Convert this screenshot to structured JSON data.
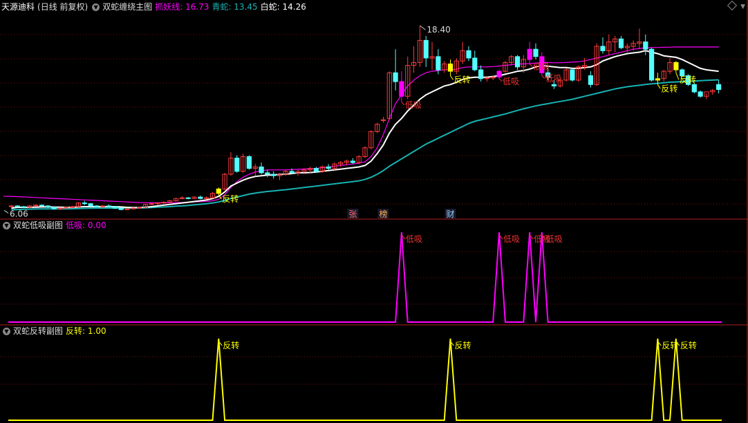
{
  "header": {
    "stock": "天源迪科",
    "period": "(日线 前复权)",
    "main_name": "双蛇缠绕主图",
    "ind1_label": "抓妖线: 16.73",
    "ind2_label": "青蛇: 13.45",
    "ind3_label": "白蛇: 14.26",
    "sub1_name": "双蛇低吸副图",
    "sub1_label": "低吸: 0.00",
    "sub2_name": "双蛇反转副图",
    "sub2_label": "反转: 1.00"
  },
  "colors": {
    "up": "#ff3b3b",
    "down": "#54ffff",
    "magenta": "#ff00ff",
    "white": "#ffffff",
    "teal": "#17b3b3",
    "yellow": "#ffff00",
    "panel_border": "#b41e1e",
    "grid": "#7a1010"
  },
  "chart_data": {
    "type": "candlestick",
    "main": {
      "ylim": [
        5.5,
        19.5
      ],
      "high_marker": "18.40",
      "low_marker": "6.06",
      "markers": [
        "张",
        "榜",
        "财"
      ],
      "signal_low": "低吸",
      "signal_rev": "反转",
      "candles": [
        [
          6.3,
          6.4,
          6.2,
          6.35
        ],
        [
          6.35,
          6.4,
          6.25,
          6.3
        ],
        [
          6.3,
          6.35,
          6.2,
          6.25
        ],
        [
          6.25,
          6.4,
          6.2,
          6.35
        ],
        [
          6.35,
          6.45,
          6.3,
          6.4
        ],
        [
          6.4,
          6.45,
          6.3,
          6.35
        ],
        [
          6.35,
          6.4,
          6.2,
          6.25
        ],
        [
          6.25,
          6.3,
          6.1,
          6.15
        ],
        [
          6.15,
          6.25,
          6.06,
          6.2
        ],
        [
          6.2,
          6.3,
          6.15,
          6.25
        ],
        [
          6.25,
          6.35,
          6.2,
          6.3
        ],
        [
          6.3,
          6.6,
          6.25,
          6.55
        ],
        [
          6.55,
          6.7,
          6.4,
          6.5
        ],
        [
          6.5,
          6.55,
          6.3,
          6.35
        ],
        [
          6.35,
          6.4,
          6.25,
          6.3
        ],
        [
          6.3,
          6.4,
          6.2,
          6.35
        ],
        [
          6.35,
          6.45,
          6.25,
          6.3
        ],
        [
          6.3,
          6.35,
          6.15,
          6.2
        ],
        [
          6.2,
          6.25,
          6.05,
          6.1
        ],
        [
          6.1,
          6.2,
          6.05,
          6.15
        ],
        [
          6.15,
          6.25,
          6.1,
          6.2
        ],
        [
          6.2,
          6.3,
          6.15,
          6.25
        ],
        [
          6.25,
          6.5,
          6.2,
          6.45
        ],
        [
          6.45,
          6.55,
          6.4,
          6.5
        ],
        [
          6.5,
          6.6,
          6.4,
          6.55
        ],
        [
          6.55,
          6.65,
          6.5,
          6.6
        ],
        [
          6.6,
          6.75,
          6.55,
          6.7
        ],
        [
          6.7,
          6.9,
          6.65,
          6.85
        ],
        [
          6.85,
          7.0,
          6.8,
          6.9
        ],
        [
          6.9,
          6.95,
          6.8,
          6.85
        ],
        [
          6.85,
          7.0,
          6.8,
          6.95
        ],
        [
          6.95,
          7.05,
          6.8,
          6.85
        ],
        [
          6.85,
          7.0,
          6.8,
          6.9
        ],
        [
          6.9,
          7.3,
          6.85,
          7.2
        ],
        [
          7.2,
          7.6,
          7.1,
          7.5
        ],
        [
          7.5,
          8.6,
          7.4,
          8.5
        ],
        [
          8.5,
          10.0,
          8.4,
          9.6
        ],
        [
          9.6,
          9.8,
          8.6,
          8.7
        ],
        [
          8.7,
          9.9,
          8.6,
          9.7
        ],
        [
          9.7,
          9.8,
          8.8,
          8.9
        ],
        [
          8.9,
          9.2,
          8.4,
          9.0
        ],
        [
          9.0,
          9.3,
          8.5,
          8.6
        ],
        [
          8.6,
          8.8,
          8.3,
          8.5
        ],
        [
          8.5,
          8.7,
          8.2,
          8.4
        ],
        [
          8.4,
          8.6,
          8.1,
          8.5
        ],
        [
          8.5,
          8.8,
          8.4,
          8.7
        ],
        [
          8.7,
          8.9,
          8.5,
          8.6
        ],
        [
          8.6,
          8.8,
          8.4,
          8.7
        ],
        [
          8.7,
          8.9,
          8.5,
          8.8
        ],
        [
          8.8,
          9.0,
          8.6,
          8.9
        ],
        [
          8.9,
          9.0,
          8.6,
          8.7
        ],
        [
          8.7,
          9.1,
          8.6,
          9.0
        ],
        [
          9.0,
          9.2,
          8.8,
          8.9
        ],
        [
          8.9,
          9.3,
          8.8,
          9.2
        ],
        [
          9.2,
          9.4,
          9.0,
          9.3
        ],
        [
          9.3,
          9.5,
          9.1,
          9.4
        ],
        [
          9.4,
          9.6,
          9.2,
          9.3
        ],
        [
          9.3,
          9.8,
          9.2,
          9.7
        ],
        [
          9.7,
          10.4,
          9.6,
          10.3
        ],
        [
          10.3,
          11.5,
          10.2,
          11.4
        ],
        [
          11.4,
          12.0,
          11.3,
          11.9
        ],
        [
          12.2,
          12.4,
          12.0,
          12.2
        ],
        [
          12.3,
          15.5,
          12.2,
          15.4
        ],
        [
          15.4,
          17.0,
          14.2,
          14.8
        ],
        [
          14.8,
          15.5,
          13.4,
          13.8
        ],
        [
          13.8,
          16.5,
          13.6,
          15.9
        ],
        [
          15.9,
          17.2,
          15.4,
          16.1
        ],
        [
          16.1,
          18.6,
          15.8,
          17.6
        ],
        [
          17.6,
          17.9,
          15.8,
          16.4
        ],
        [
          16.4,
          17.5,
          15.6,
          16.5
        ],
        [
          16.5,
          17.0,
          15.3,
          15.6
        ],
        [
          15.6,
          16.2,
          15.4,
          16.0
        ],
        [
          16.0,
          16.3,
          15.2,
          15.5
        ],
        [
          15.5,
          16.4,
          15.3,
          16.2
        ],
        [
          16.2,
          17.5,
          16.0,
          16.9
        ],
        [
          16.9,
          17.2,
          16.2,
          16.4
        ],
        [
          16.4,
          16.9,
          15.5,
          15.6
        ],
        [
          15.6,
          15.9,
          14.8,
          15.0
        ],
        [
          15.0,
          15.1,
          14.8,
          15.05
        ],
        [
          15.05,
          15.2,
          14.9,
          15.1
        ],
        [
          15.1,
          15.6,
          15.0,
          15.5
        ],
        [
          15.5,
          16.2,
          15.4,
          16.1
        ],
        [
          16.1,
          16.6,
          15.9,
          16.5
        ],
        [
          16.5,
          16.6,
          15.6,
          15.8
        ],
        [
          15.8,
          16.6,
          15.4,
          16.3
        ],
        [
          16.3,
          17.5,
          16.0,
          17.0
        ],
        [
          17.0,
          17.4,
          16.3,
          16.5
        ],
        [
          16.5,
          16.8,
          15.2,
          15.4
        ],
        [
          15.4,
          15.8,
          14.9,
          15.1
        ],
        [
          14.6,
          14.9,
          14.3,
          14.5
        ],
        [
          14.5,
          15.0,
          14.4,
          14.9
        ],
        [
          14.9,
          15.7,
          14.8,
          15.6
        ],
        [
          15.6,
          15.7,
          14.8,
          14.9
        ],
        [
          14.9,
          15.9,
          14.8,
          15.8
        ],
        [
          15.8,
          16.4,
          15.6,
          15.9
        ],
        [
          15.2,
          15.5,
          14.4,
          14.6
        ],
        [
          14.6,
          17.4,
          14.5,
          17.2
        ],
        [
          17.2,
          17.8,
          16.7,
          16.9
        ],
        [
          16.9,
          18.0,
          16.6,
          17.5
        ],
        [
          17.5,
          17.9,
          16.8,
          17.7
        ],
        [
          17.7,
          17.9,
          17.0,
          17.1
        ],
        [
          17.1,
          17.4,
          16.8,
          17.2
        ],
        [
          17.2,
          17.6,
          16.9,
          17.4
        ],
        [
          17.4,
          18.4,
          17.0,
          17.5
        ],
        [
          17.5,
          18.0,
          16.6,
          17.0
        ],
        [
          17.0,
          17.1,
          14.8,
          14.9
        ],
        [
          14.9,
          15.4,
          14.6,
          15.0
        ],
        [
          15.0,
          15.6,
          14.8,
          15.5
        ],
        [
          15.5,
          16.4,
          15.3,
          16.1
        ],
        [
          16.1,
          16.2,
          15.4,
          15.6
        ],
        [
          15.6,
          15.7,
          15.1,
          15.2
        ],
        [
          15.2,
          15.3,
          14.5,
          14.6
        ],
        [
          14.6,
          14.7,
          14.0,
          14.1
        ],
        [
          14.1,
          14.2,
          13.7,
          13.8
        ],
        [
          13.8,
          14.0,
          13.6,
          14.1
        ],
        [
          14.1,
          14.3,
          13.9,
          14.2
        ],
        [
          14.6,
          14.9,
          14.0,
          14.26
        ]
      ],
      "white_line": [
        6.2,
        6.25,
        6.25,
        6.25,
        6.26,
        6.28,
        6.28,
        6.27,
        6.26,
        6.25,
        6.25,
        6.28,
        6.3,
        6.3,
        6.3,
        6.3,
        6.3,
        6.3,
        6.28,
        6.25,
        6.24,
        6.24,
        6.26,
        6.3,
        6.35,
        6.4,
        6.45,
        6.5,
        6.55,
        6.6,
        6.65,
        6.7,
        6.75,
        6.85,
        7.0,
        7.3,
        7.7,
        7.9,
        8.1,
        8.25,
        8.35,
        8.4,
        8.45,
        8.45,
        8.5,
        8.5,
        8.55,
        8.6,
        8.6,
        8.62,
        8.65,
        8.7,
        8.75,
        8.8,
        8.85,
        8.9,
        8.95,
        9.0,
        9.1,
        9.4,
        9.9,
        10.5,
        11.3,
        11.9,
        12.3,
        12.8,
        13.2,
        13.6,
        13.9,
        14.1,
        14.3,
        14.5,
        14.6,
        14.75,
        14.95,
        15.05,
        15.1,
        15.1,
        15.1,
        15.15,
        15.2,
        15.3,
        15.4,
        15.5,
        15.55,
        15.65,
        15.8,
        15.9,
        15.85,
        15.8,
        15.75,
        15.75,
        15.7,
        15.7,
        15.75,
        15.8,
        15.95,
        16.2,
        16.35,
        16.5,
        16.6,
        16.7,
        16.75,
        16.8,
        16.9,
        16.8,
        16.7,
        16.55,
        16.5,
        16.45,
        16.3,
        16.1,
        15.9,
        15.7,
        15.6,
        15.55,
        15.5
      ],
      "magenta_line": [
        7.0,
        6.98,
        6.96,
        6.94,
        6.92,
        6.9,
        6.88,
        6.86,
        6.84,
        6.82,
        6.8,
        6.78,
        6.76,
        6.74,
        6.72,
        6.7,
        6.68,
        6.66,
        6.64,
        6.62,
        6.6,
        6.58,
        6.57,
        6.56,
        6.56,
        6.56,
        6.56,
        6.57,
        6.58,
        6.6,
        6.62,
        6.64,
        6.66,
        6.7,
        6.8,
        7.1,
        7.6,
        8.0,
        8.3,
        8.5,
        8.65,
        8.75,
        8.8,
        8.8,
        8.8,
        8.8,
        8.82,
        8.84,
        8.86,
        8.88,
        8.9,
        8.95,
        9.0,
        9.05,
        9.1,
        9.15,
        9.2,
        9.25,
        9.35,
        9.7,
        10.3,
        11.2,
        12.3,
        13.3,
        13.9,
        14.5,
        14.9,
        15.2,
        15.4,
        15.5,
        15.55,
        15.6,
        15.6,
        15.65,
        15.75,
        15.8,
        15.8,
        15.8,
        15.8,
        15.82,
        15.86,
        15.9,
        15.95,
        16.0,
        16.0,
        16.02,
        16.05,
        16.1,
        16.1,
        16.08,
        16.08,
        16.1,
        16.12,
        16.15,
        16.2,
        16.3,
        16.4,
        16.5,
        16.6,
        16.7,
        16.8,
        16.9,
        17.0,
        17.05,
        17.1,
        17.12,
        17.12,
        17.13,
        17.14,
        17.15,
        17.15,
        17.15,
        17.15,
        17.15,
        17.15,
        17.15,
        17.15
      ],
      "teal_line": [
        6.1,
        6.1,
        6.12,
        6.13,
        6.14,
        6.15,
        6.15,
        6.15,
        6.15,
        6.15,
        6.16,
        6.17,
        6.18,
        6.19,
        6.2,
        6.2,
        6.2,
        6.2,
        6.2,
        6.2,
        6.2,
        6.21,
        6.22,
        6.24,
        6.26,
        6.28,
        6.3,
        6.33,
        6.35,
        6.38,
        6.42,
        6.46,
        6.5,
        6.55,
        6.62,
        6.72,
        6.85,
        6.95,
        7.05,
        7.15,
        7.22,
        7.28,
        7.33,
        7.37,
        7.41,
        7.45,
        7.5,
        7.55,
        7.6,
        7.65,
        7.7,
        7.75,
        7.8,
        7.85,
        7.9,
        7.95,
        8.0,
        8.05,
        8.15,
        8.3,
        8.5,
        8.75,
        9.05,
        9.3,
        9.55,
        9.8,
        10.05,
        10.3,
        10.55,
        10.75,
        10.95,
        11.15,
        11.35,
        11.55,
        11.75,
        11.95,
        12.1,
        12.2,
        12.3,
        12.4,
        12.5,
        12.6,
        12.72,
        12.84,
        12.95,
        13.05,
        13.15,
        13.23,
        13.3,
        13.38,
        13.45,
        13.52,
        13.6,
        13.7,
        13.8,
        13.9,
        14.0,
        14.1,
        14.2,
        14.3,
        14.38,
        14.45,
        14.5,
        14.55,
        14.6,
        14.65,
        14.68,
        14.72,
        14.76,
        14.78,
        14.8,
        14.82,
        14.84,
        14.86,
        14.88,
        14.9,
        14.92
      ]
    },
    "sub1": {
      "signal_idx": [
        64,
        80,
        85,
        87
      ],
      "label": "低吸"
    },
    "sub2": {
      "signal_idx": [
        34,
        72,
        106,
        109
      ],
      "label": "反转"
    }
  }
}
